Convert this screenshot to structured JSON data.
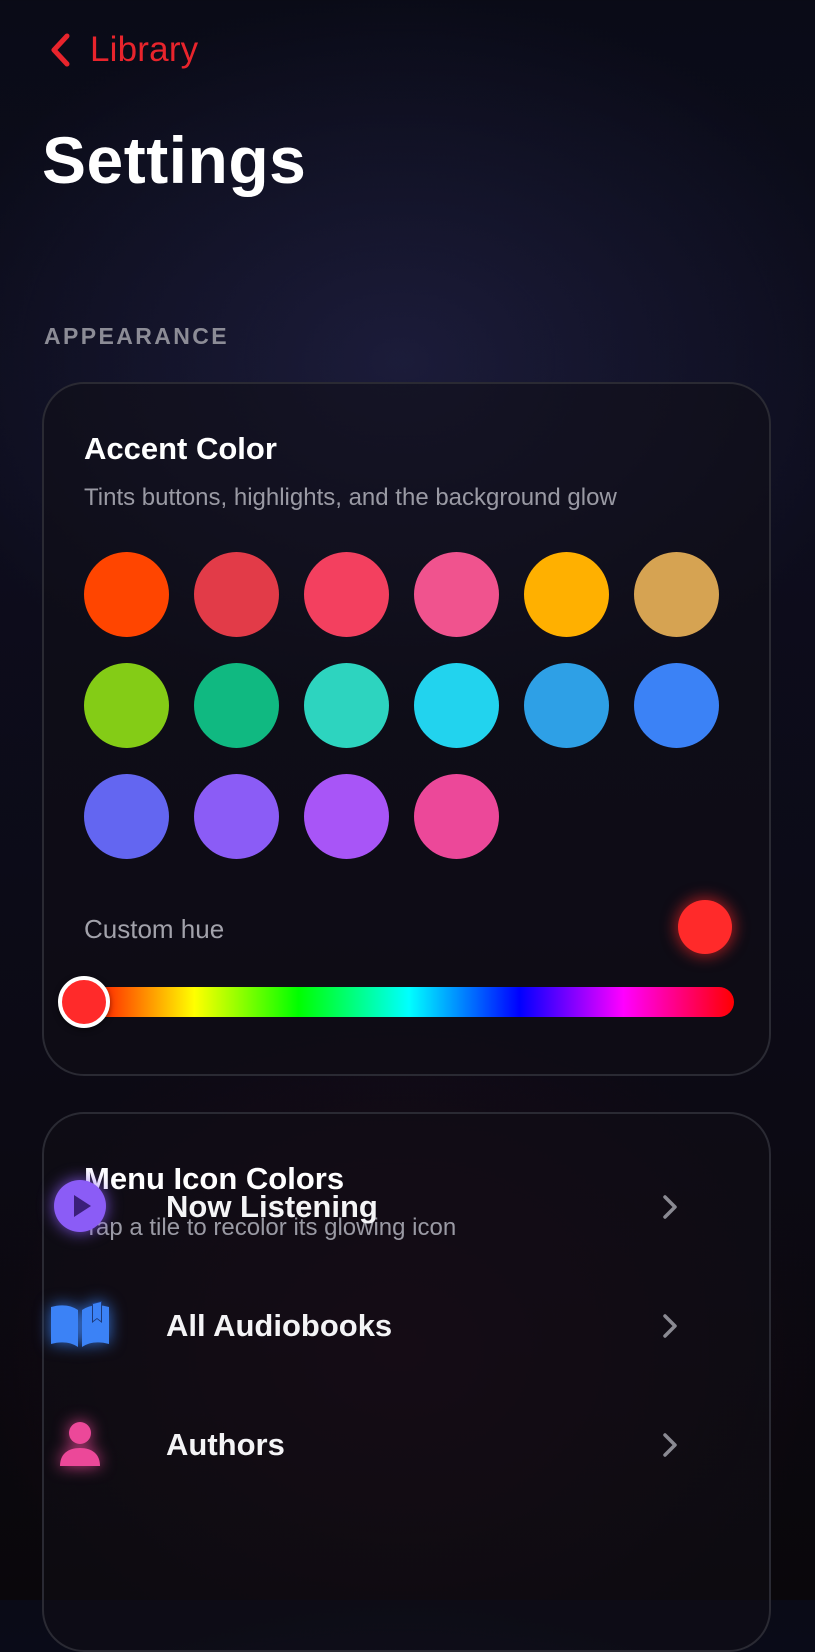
{
  "nav": {
    "back_label": "Library",
    "back_icon": "chevron-left-icon",
    "accent": "#e8242c"
  },
  "page_title": "Settings",
  "section": {
    "label": "APPEARANCE"
  },
  "accent_color": {
    "title": "Accent Color",
    "subtitle": "Tints buttons, highlights, and the background glow",
    "swatches": [
      "#ff4500",
      "#e23b48",
      "#f3405f",
      "#f0538e",
      "#ffb000",
      "#d6a352",
      "#84cc16",
      "#10b981",
      "#2dd4bf",
      "#22d3ee",
      "#2ea0e6",
      "#3b82f6",
      "#6366f1",
      "#8b5cf6",
      "#a855f7",
      "#ec4899"
    ],
    "custom_hue_label": "Custom hue",
    "custom_hue_color": "#ff2a2a",
    "custom_hue_value": 0
  },
  "menu_icon_colors": {
    "title": "Menu Icon Colors",
    "subtitle": "Tap a tile to recolor its glowing icon",
    "items": [
      {
        "label": "Now Listening",
        "icon": "play-circle-icon",
        "color": "#8b5cf6"
      },
      {
        "label": "All Audiobooks",
        "icon": "open-book-icon",
        "color": "#3b82f6"
      },
      {
        "label": "Authors",
        "icon": "person-icon",
        "color": "#ec4899"
      }
    ]
  }
}
